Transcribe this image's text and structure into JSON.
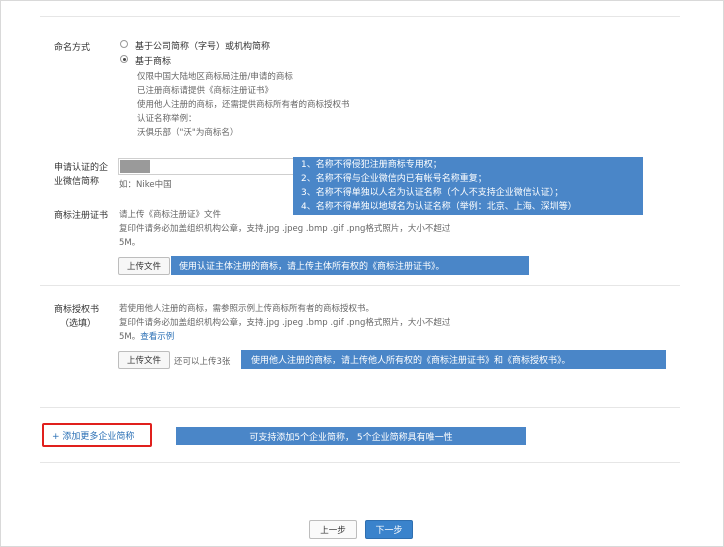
{
  "naming": {
    "label": "命名方式",
    "option1": "基于公司简称（字号）或机构简称",
    "option2": "基于商标",
    "desc": [
      "仅限中国大陆地区商标局注册/申请的商标",
      "已注册商标请提供《商标注册证书》",
      "使用他人注册的商标，还需提供商标所有者的商标授权书",
      "认证名称举例：",
      "沃俱乐部（\"沃\"为商标名）"
    ]
  },
  "wechat_name": {
    "label_line1": "申请认证的企",
    "label_line2": "业微信简称",
    "placeholder_hint": "如：Nike中国",
    "callout_lines": [
      "1、名称不得侵犯注册商标专用权；",
      "2、名称不得与企业微信内已有帐号名称重复；",
      "3、名称不得单独以人名为认证名称（个人不支持企业微信认证）；",
      "4、名称不得单独以地域名为认证名称（举例：北京、上海、深圳等）"
    ]
  },
  "trademark_cert": {
    "label": "商标注册证书",
    "line1": "请上传《商标注册证》文件",
    "line2": "复印件请务必加盖组织机构公章，支持.jpg .jpeg .bmp .gif .png格式照片，大小不超过",
    "line3": "5M。",
    "upload_label": "上传文件",
    "callout": "使用认证主体注册的商标，请上传主体所有权的《商标注册证书》。"
  },
  "trademark_auth": {
    "label_line1": "商标授权书",
    "label_line2": "（选填）",
    "line1": "若使用他人注册的商标，需参照示例上传商标所有者的商标授权书。",
    "line2": "复印件请务必加盖组织机构公章，支持.jpg .jpeg .bmp .gif .png格式照片，大小不超过",
    "line3_prefix": "5M。",
    "example_link": "查看示例",
    "upload_label": "上传文件",
    "remaining": "还可以上传3张",
    "callout": "使用他人注册的商标，请上传他人所有权的《商标注册证书》和《商标授权书》。"
  },
  "add_more": {
    "label": "+ 添加更多企业简称",
    "callout": "可支持添加5个企业简称， 5个企业简称具有唯一性"
  },
  "footer": {
    "prev": "上一步",
    "next": "下一步"
  }
}
